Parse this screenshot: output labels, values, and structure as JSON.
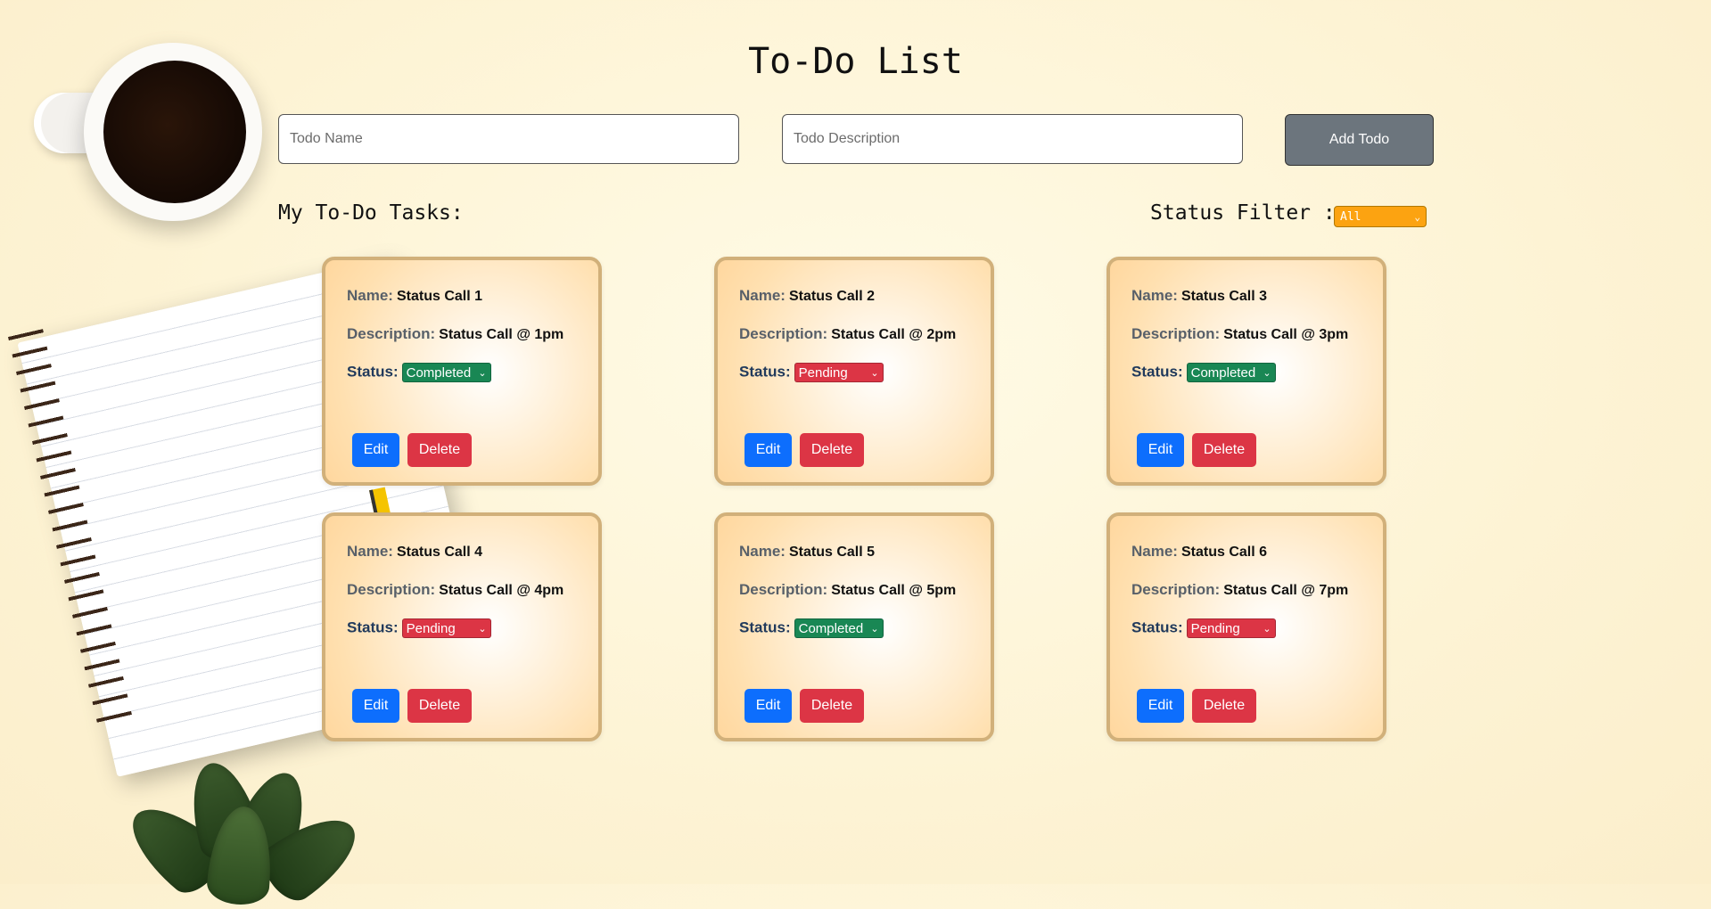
{
  "title": "To-Do List",
  "form": {
    "name_placeholder": "Todo Name",
    "description_placeholder": "Todo Description",
    "add_label": "Add Todo"
  },
  "section_title": "My To-Do Tasks:",
  "filter": {
    "label": "Status Filter :",
    "value": "All"
  },
  "labels": {
    "name": "Name:",
    "description": "Description:",
    "status": "Status:",
    "edit": "Edit",
    "delete": "Delete"
  },
  "todos": [
    {
      "name": "Status Call 1",
      "description": "Status Call @ 1pm",
      "status": "Completed"
    },
    {
      "name": "Status Call 2",
      "description": "Status Call @ 2pm",
      "status": "Pending"
    },
    {
      "name": "Status Call 3",
      "description": "Status Call @ 3pm",
      "status": "Completed"
    },
    {
      "name": "Status Call 4",
      "description": "Status Call @ 4pm",
      "status": "Pending"
    },
    {
      "name": "Status Call 5",
      "description": "Status Call @ 5pm",
      "status": "Completed"
    },
    {
      "name": "Status Call 6",
      "description": "Status Call @ 7pm",
      "status": "Pending"
    }
  ],
  "colors": {
    "completed": "#198754",
    "pending": "#dc3545",
    "edit": "#0d6efd",
    "add_button": "#6c757d",
    "filter": "#fca311"
  }
}
